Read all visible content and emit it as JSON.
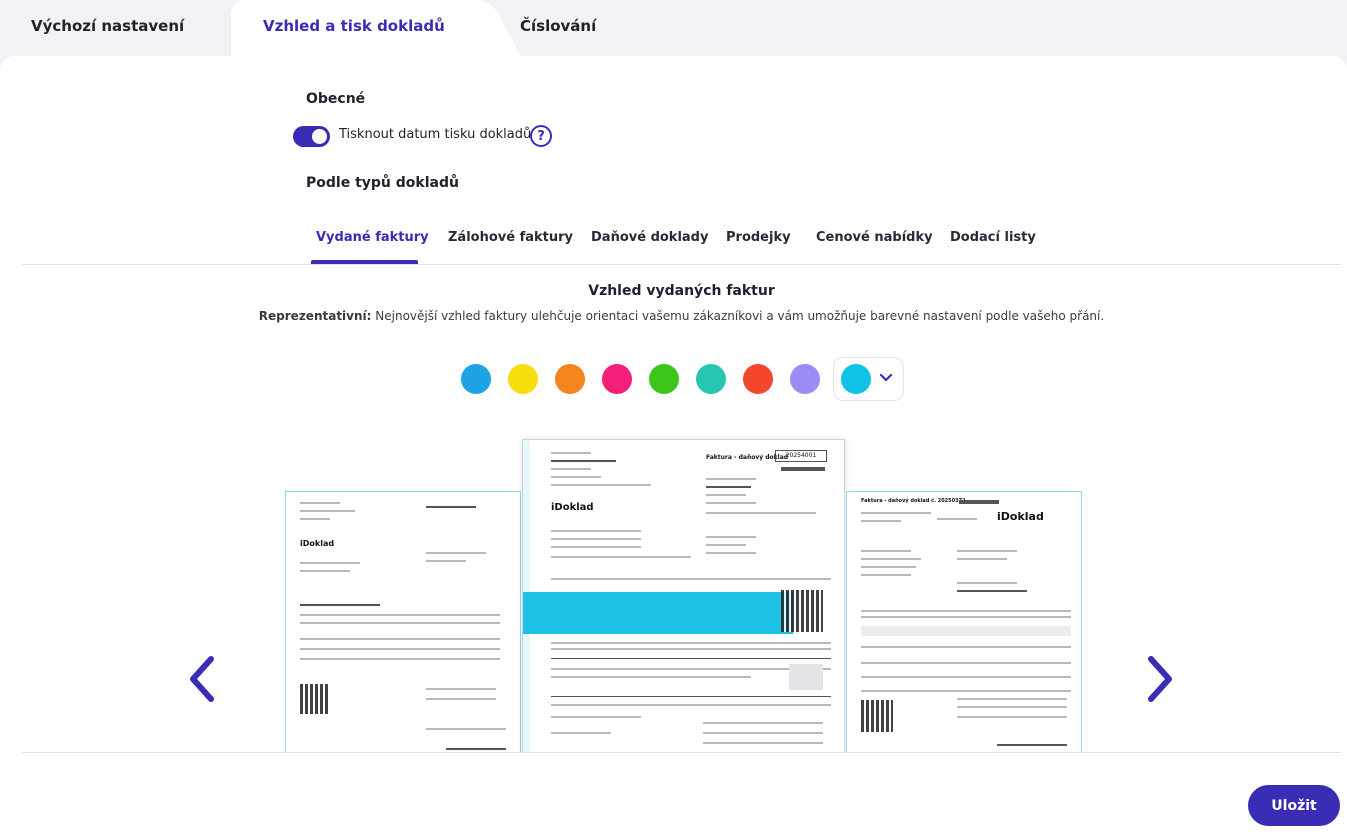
{
  "top_tabs": [
    {
      "label": "Výchozí nastavení",
      "active": false
    },
    {
      "label": "Vzhled a tisk dokladů",
      "active": true
    },
    {
      "label": "Číslování",
      "active": false
    }
  ],
  "general": {
    "title": "Obecné",
    "toggle_label": "Tisknout datum tisku dokladů",
    "toggle_on": true,
    "help_icon": "?"
  },
  "by_type": {
    "title": "Podle typů dokladů",
    "tabs": [
      {
        "label": "Vydané faktury",
        "active": true
      },
      {
        "label": "Zálohové faktury",
        "active": false
      },
      {
        "label": "Daňové doklady",
        "active": false
      },
      {
        "label": "Prodejky",
        "active": false
      },
      {
        "label": "Cenové nabídky",
        "active": false
      },
      {
        "label": "Dodací listy",
        "active": false
      }
    ]
  },
  "appearance": {
    "heading": "Vzhled vydaných faktur",
    "desc_strong": "Reprezentativní:",
    "desc_text": " Nejnovější vzhled faktury ulehčuje orientaci vašemu zákazníkovi a vám umožňuje barevné nastavení podle vašeho přání."
  },
  "colors": [
    "#1ea3e6",
    "#f5de0a",
    "#f5841f",
    "#f51f7a",
    "#3cc41a",
    "#26c6b0",
    "#f5472d",
    "#9a8cf5"
  ],
  "custom_color": "#0fc2e6",
  "accent": "#3a2db5",
  "invoice_preview": {
    "logo": "iDoklad",
    "title": "Faktura - daňový doklad",
    "number": "20254001",
    "side_title": "Faktura - daňový doklad č. 20250372"
  },
  "icons": {
    "prev": "chevron-left-icon",
    "next": "chevron-right-icon",
    "dropdown": "chevron-down-icon"
  },
  "save_label": "Uložit"
}
